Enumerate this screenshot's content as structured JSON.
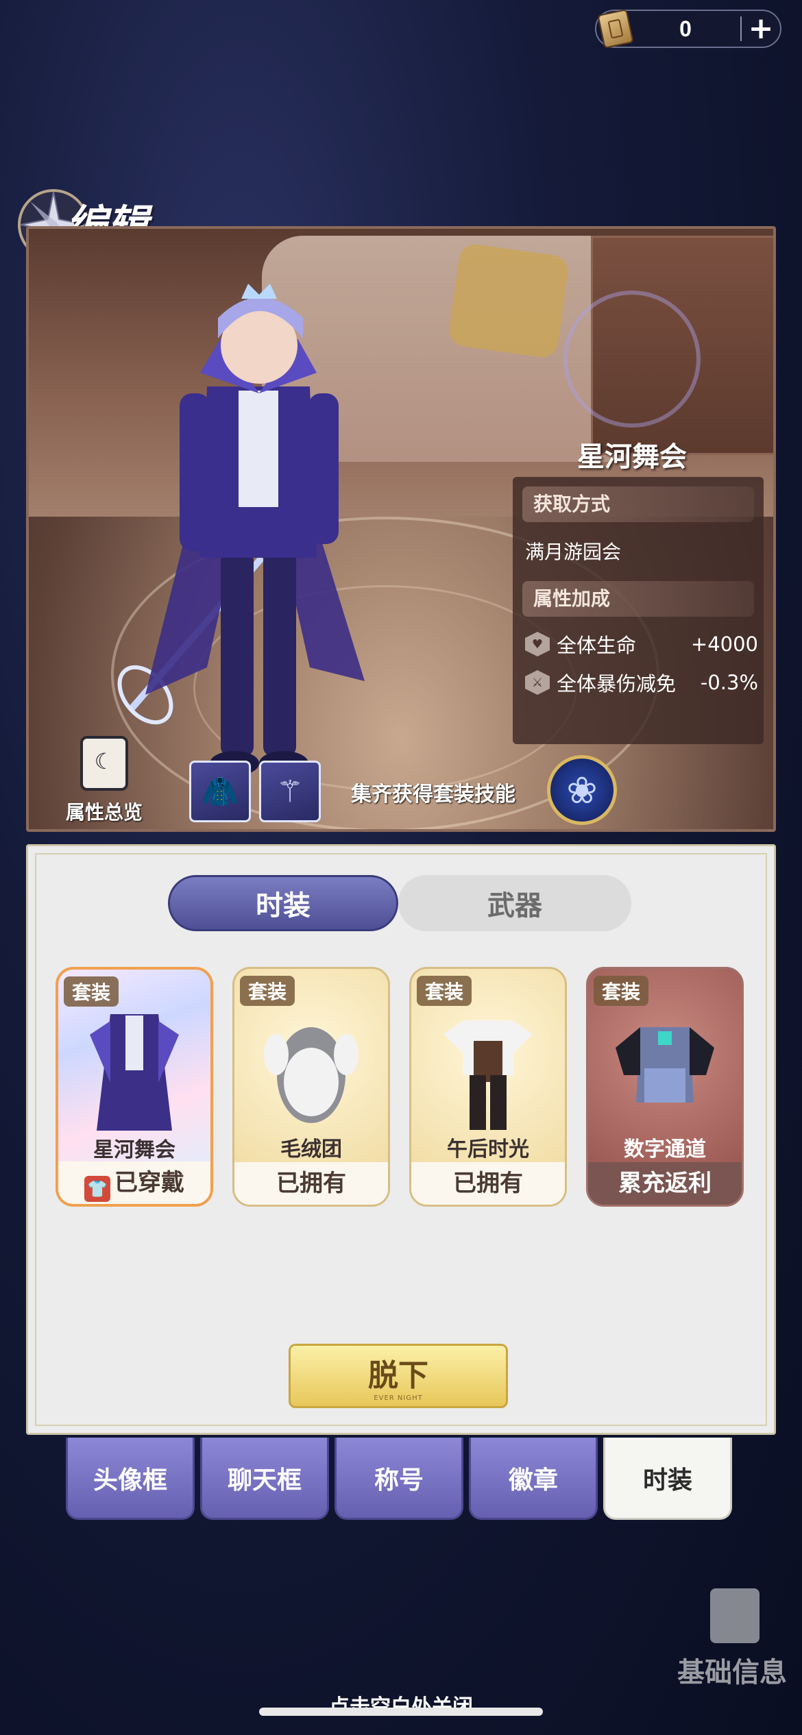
{
  "top_bar": {
    "currency_icon": "ticket-scroll-icon",
    "currency_amount": "0",
    "add_icon": "plus-icon"
  },
  "header": {
    "title": "编辑",
    "badge_icon": "compass-star-icon"
  },
  "preview": {
    "outfit_name": "星河舞会",
    "info": {
      "acquire_header": "获取方式",
      "acquire_value": "满月游园会",
      "attr_header": "属性加成",
      "stats": [
        {
          "icon": "heart-shield-icon",
          "label": "全体生命",
          "value": "+4000"
        },
        {
          "icon": "sword-shield-icon",
          "label": "全体暴伤减免",
          "value": "-0.3%"
        }
      ]
    },
    "summary_label": "属性总览",
    "summary_icon": "book-moon-icon",
    "pieces": [
      {
        "icon": "coat-icon"
      },
      {
        "icon": "staff-icon"
      }
    ],
    "set_skill_label": "集齐获得套装技能",
    "skill_icon": "blue-rose-icon"
  },
  "wardrobe": {
    "tabs": [
      {
        "label": "时装",
        "active": true
      },
      {
        "label": "武器",
        "active": false
      }
    ],
    "cards": [
      {
        "tag": "套装",
        "name": "星河舞会",
        "status": "已穿戴",
        "status_icon": "wearing-icon"
      },
      {
        "tag": "套装",
        "name": "毛绒团",
        "status": "已拥有"
      },
      {
        "tag": "套装",
        "name": "午后时光",
        "status": "已拥有"
      },
      {
        "tag": "套装",
        "name": "数字通道",
        "status": "累充返利"
      }
    ],
    "take_off_label": "脱下",
    "take_off_sub": "EVER NIGHT"
  },
  "categories": [
    {
      "label": "头像框"
    },
    {
      "label": "聊天框"
    },
    {
      "label": "称号"
    },
    {
      "label": "徽章"
    },
    {
      "label": "时装",
      "active": true
    }
  ],
  "base_info_label": "基础信息",
  "close_hint": "点击空白处关闭",
  "colors": {
    "accent_purple": "#5f5fa8",
    "gold": "#e7c75a",
    "card_border_active": "#f0a050"
  }
}
